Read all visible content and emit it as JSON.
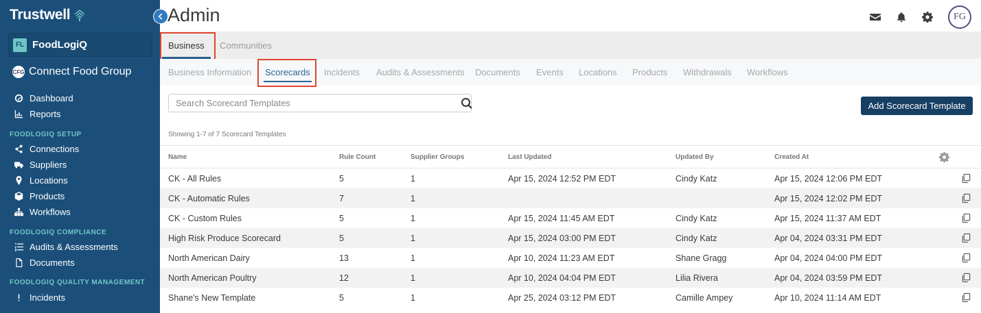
{
  "sidebar": {
    "brand": "Trustwell",
    "app_badge": "FL",
    "app_name": "FoodLogiQ",
    "org_name": "Connect Food Group",
    "org_logo_text": "CFG",
    "nav_top": [
      {
        "label": "Dashboard",
        "icon": "dashboard-icon"
      },
      {
        "label": "Reports",
        "icon": "bar-chart-icon"
      }
    ],
    "sections": [
      {
        "title": "FOODLOGIQ SETUP",
        "items": [
          {
            "label": "Connections",
            "icon": "share-icon"
          },
          {
            "label": "Suppliers",
            "icon": "truck-icon"
          },
          {
            "label": "Locations",
            "icon": "map-marker-icon"
          },
          {
            "label": "Products",
            "icon": "cube-icon"
          },
          {
            "label": "Workflows",
            "icon": "sitemap-icon"
          }
        ]
      },
      {
        "title": "FOODLOGIQ COMPLIANCE",
        "items": [
          {
            "label": "Audits & Assessments",
            "icon": "list-ordered-icon"
          },
          {
            "label": "Documents",
            "icon": "file-icon"
          }
        ]
      },
      {
        "title": "FOODLOGIQ QUALITY MANAGEMENT",
        "items": [
          {
            "label": "Incidents",
            "icon": "exclamation-icon"
          }
        ]
      }
    ]
  },
  "header": {
    "title": "Admin",
    "avatar_text": "FG"
  },
  "tabs_primary": [
    {
      "label": "Business",
      "active": true
    },
    {
      "label": "Communities",
      "active": false
    }
  ],
  "tabs_secondary": [
    {
      "label": "Business Information",
      "active": false
    },
    {
      "label": "Scorecards",
      "active": true
    },
    {
      "label": "Incidents",
      "active": false
    },
    {
      "label": "Audits & Assessments",
      "active": false
    },
    {
      "label": "Documents",
      "active": false
    },
    {
      "label": "Events",
      "active": false
    },
    {
      "label": "Locations",
      "active": false
    },
    {
      "label": "Products",
      "active": false
    },
    {
      "label": "Withdrawals",
      "active": false
    },
    {
      "label": "Workflows",
      "active": false
    }
  ],
  "search": {
    "placeholder": "Search Scorecard Templates",
    "value": ""
  },
  "add_button": "Add Scorecard Template",
  "showing_text": "Showing 1-7 of 7 Scorecard Templates",
  "table": {
    "columns": [
      "Name",
      "Rule Count",
      "Supplier Groups",
      "Last Updated",
      "Updated By",
      "Created At"
    ],
    "rows": [
      [
        "CK - All Rules",
        "5",
        "1",
        "Apr 15, 2024 12:52 PM EDT",
        "Cindy Katz",
        "Apr 15, 2024 12:06 PM EDT"
      ],
      [
        "CK - Automatic Rules",
        "7",
        "1",
        "",
        "",
        "Apr 15, 2024 12:02 PM EDT"
      ],
      [
        "CK - Custom Rules",
        "5",
        "1",
        "Apr 15, 2024 11:45 AM EDT",
        "Cindy Katz",
        "Apr 15, 2024 11:37 AM EDT"
      ],
      [
        "High Risk Produce Scorecard",
        "5",
        "1",
        "Apr 15, 2024 03:00 PM EDT",
        "Cindy Katz",
        "Apr 04, 2024 03:31 PM EDT"
      ],
      [
        "North American Dairy",
        "13",
        "1",
        "Apr 10, 2024 11:23 AM EDT",
        "Shane Gragg",
        "Apr 04, 2024 04:00 PM EDT"
      ],
      [
        "North American Poultry",
        "12",
        "1",
        "Apr 10, 2024 04:04 PM EDT",
        "Lilia Rivera",
        "Apr 04, 2024 03:59 PM EDT"
      ],
      [
        "Shane's New Template",
        "5",
        "1",
        "Apr 25, 2024 03:12 PM EDT",
        "Camille Ampey",
        "Apr 10, 2024 11:14 AM EDT"
      ]
    ]
  },
  "colors": {
    "sidebar_bg": "#1b4f7a",
    "section_title": "#6fc6c4",
    "primary_button": "#173e63",
    "active_tab": "#2a6496",
    "highlight_box": "#e0432f"
  }
}
